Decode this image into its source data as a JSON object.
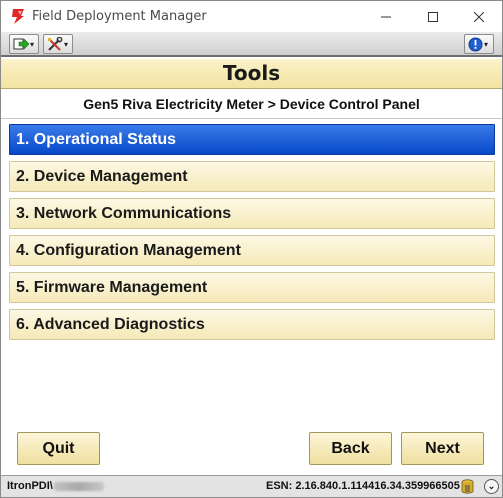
{
  "window": {
    "title": "Field Deployment Manager"
  },
  "toolbar": {
    "export_icon": "export-arrow-icon",
    "tools_icon": "tools-wrench-icon",
    "info_icon": "info-icon",
    "caret": "▾"
  },
  "header": {
    "title": "Tools",
    "breadcrumb": "Gen5 Riva Electricity Meter  >  Device Control Panel"
  },
  "menu": {
    "items": [
      {
        "label": "1. Operational Status",
        "selected": true
      },
      {
        "label": "2. Device Management",
        "selected": false
      },
      {
        "label": "3. Network Communications",
        "selected": false
      },
      {
        "label": "4. Configuration Management",
        "selected": false
      },
      {
        "label": "5. Firmware Management",
        "selected": false
      },
      {
        "label": "6. Advanced Diagnostics",
        "selected": false
      }
    ]
  },
  "footer": {
    "quit_label": "Quit",
    "back_label": "Back",
    "next_label": "Next"
  },
  "status": {
    "user_prefix": "ItronPDI\\",
    "esn": "ESN: 2.16.840.1.114416.34.359966505",
    "arrow": "⌄"
  },
  "colors": {
    "selected_bg": "#0748c8",
    "item_bg": "#f5e9b8",
    "header_bg": "#f3e3a2"
  }
}
